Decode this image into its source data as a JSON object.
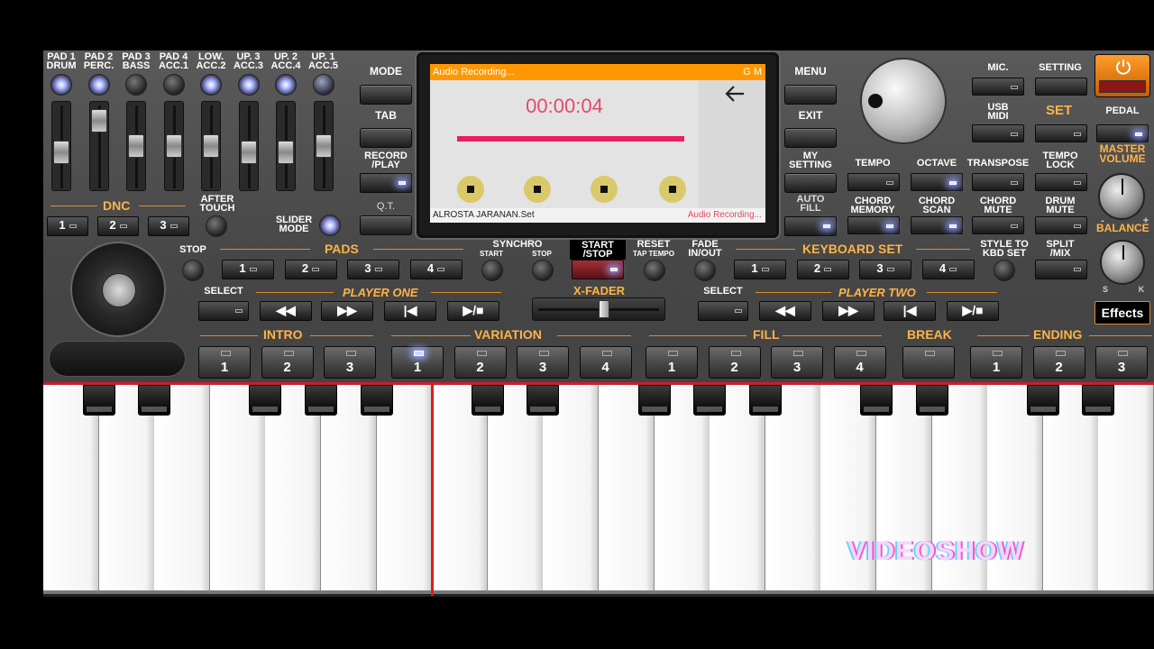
{
  "mixer": {
    "channels": [
      {
        "label": "PAD 1\nDRUM",
        "state": "lit",
        "level": 0.45
      },
      {
        "label": "PAD 2\nPERC.",
        "state": "lit",
        "level": 0.95
      },
      {
        "label": "PAD 3\nBASS",
        "state": "dark",
        "level": 0.55
      },
      {
        "label": "PAD 4\nACC.1",
        "state": "dark",
        "level": 0.55
      },
      {
        "label": "LOW.\nACC.2",
        "state": "lit",
        "level": 0.55
      },
      {
        "label": "UP. 3\nACC.3",
        "state": "lit",
        "level": 0.45
      },
      {
        "label": "UP. 2\nACC.4",
        "state": "lit",
        "level": 0.45
      },
      {
        "label": "UP. 1\nACC.5",
        "state": "off",
        "level": 0.55
      }
    ],
    "dnc_label": "DNC",
    "dnc_buttons": [
      "1",
      "2",
      "3"
    ],
    "after_touch_label": "AFTER\nTOUCH",
    "slider_mode_label": "SLIDER\nMODE"
  },
  "left_menu": {
    "mode": "MODE",
    "tab": "TAB",
    "record_play": "RECORD\n/PLAY",
    "qt": "Q.T."
  },
  "screen": {
    "header": "Audio Recording...",
    "header_right": "G M",
    "timer": "00:00:04",
    "progress": 1.0,
    "footer_left": "ALROSTA JARANAN.Set",
    "footer_right": "Audio Recording...",
    "back_icon": "arrow-left-icon"
  },
  "right_menu": {
    "menu": "MENU",
    "exit": "EXIT",
    "my_setting": "MY\nSETTING",
    "auto_fill": "AUTO\nFILL"
  },
  "controls": {
    "mic": "MIC.",
    "setting": "SETTING",
    "usb_midi": "USB\nMIDI",
    "set": "SET",
    "pedal": "PEDAL",
    "tempo": "TEMPO",
    "octave": "OCTAVE",
    "transpose": "TRANSPOSE",
    "tempo_lock": "TEMPO\nLOCK",
    "master_volume": "MASTER\nVOLUME",
    "chord_memory": "CHORD\nMEMORY",
    "chord_scan": "CHORD\nSCAN",
    "chord_mute": "CHORD\nMUTE",
    "drum_mute": "DRUM\nMUTE",
    "balance": "BALANCE",
    "balance_minus": "-",
    "balance_plus": "+",
    "balance_s": "S",
    "balance_k": "K"
  },
  "transport": {
    "stop": "STOP",
    "pads": "PADS",
    "pad_buttons": [
      "1",
      "2",
      "3",
      "4"
    ],
    "synchro": "SYNCHRO",
    "synchro_start": "START",
    "synchro_stop": "STOP",
    "start_stop": "START\n/STOP",
    "reset": "RESET",
    "tap_tempo": "TAP TEMPO",
    "fade": "FADE\nIN/OUT",
    "keyboard_set": "KEYBOARD SET",
    "keyboard_set_buttons": [
      "1",
      "2",
      "3",
      "4"
    ],
    "style_to_kbd": "STYLE TO\nKBD SET",
    "split_mix": "SPLIT\n/MIX"
  },
  "players": {
    "select": "SELECT",
    "player_one": "PLAYER ONE",
    "xfader": "X-FADER",
    "player_two": "PLAYER TWO",
    "xfader_value": 0.55
  },
  "effects": "Effects",
  "sections": {
    "intro": "INTRO",
    "intro_pads": [
      "1",
      "2",
      "3"
    ],
    "variation": "VARIATION",
    "variation_pads": [
      "1",
      "2",
      "3",
      "4"
    ],
    "fill": "FILL",
    "fill_pads": [
      "1",
      "2",
      "3",
      "4"
    ],
    "break": "BREAK",
    "ending": "ENDING",
    "ending_pads": [
      "1",
      "2",
      "3"
    ]
  },
  "watermark": "VIDEOSHOW",
  "colors": {
    "accent_orange": "#ffb347",
    "recording_bar": "#e91e63",
    "timer_red": "#e24a6a",
    "screen_header": "#ff9800",
    "effects_bg": "#000000"
  }
}
